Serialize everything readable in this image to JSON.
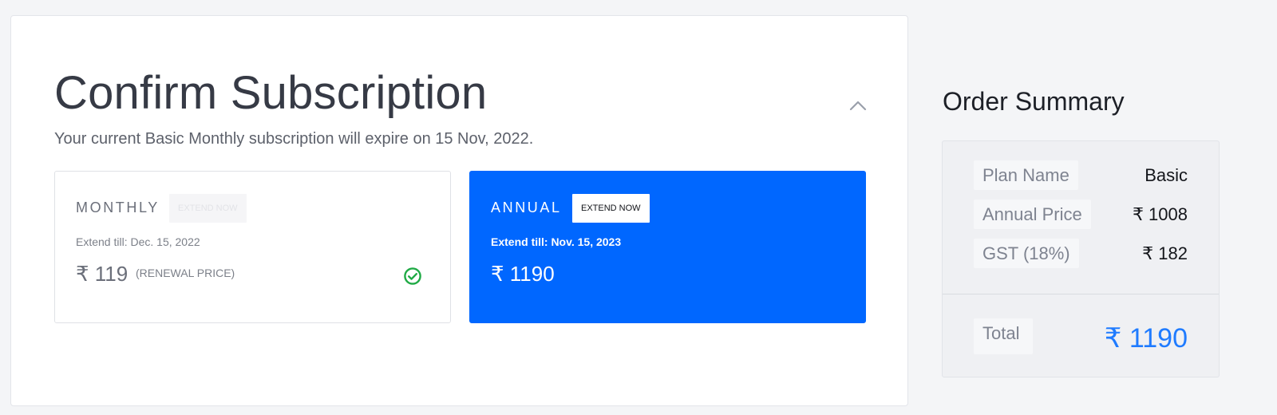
{
  "subscription": {
    "title": "Confirm Subscription",
    "subtitle": "Your current Basic Monthly subscription will expire on 15 Nov, 2022."
  },
  "plans": [
    {
      "name": "MONTHLY",
      "extend_button": "EXTEND NOW",
      "extend_till": "Extend till: Dec. 15, 2022",
      "price": "₹ 119",
      "note": "(RENEWAL PRICE)",
      "selected_icon": "check-circle-icon",
      "selected_icon_color": "#1faa45"
    },
    {
      "name": "ANNUAL",
      "extend_button": "EXTEND NOW",
      "extend_till": "Extend till: Nov. 15, 2023",
      "price": "₹ 1190",
      "background_color": "#0067ff"
    }
  ],
  "order_summary": {
    "title": "Order Summary",
    "rows": [
      {
        "label": "Plan Name",
        "value": "Basic"
      },
      {
        "label": "Annual Price",
        "value": "₹ 1008"
      },
      {
        "label": "GST (18%)",
        "value": "₹ 182"
      }
    ],
    "total_label": "Total",
    "total_value": "₹ 1190",
    "total_color": "#1f7bff"
  },
  "icons": {
    "collapse": "chevron-up-icon"
  }
}
